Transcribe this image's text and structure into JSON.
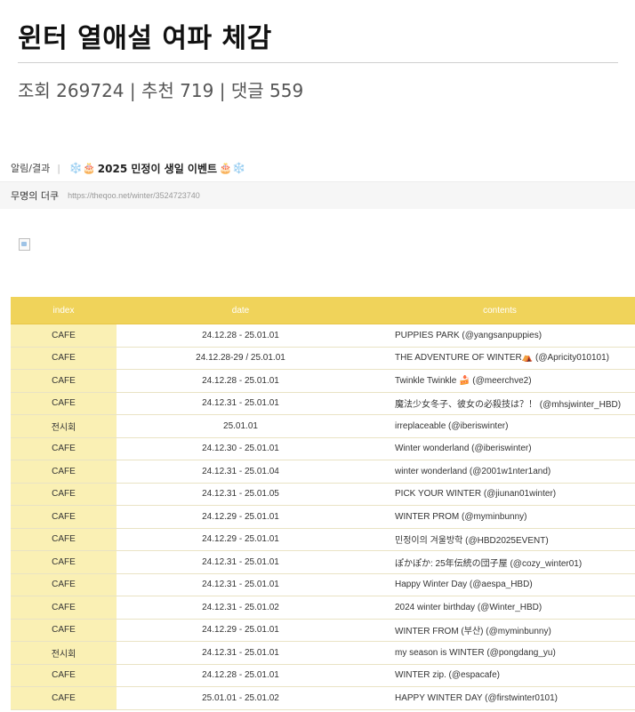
{
  "post": {
    "title": "윈터 열애설 여파 체감",
    "views_label": "조회",
    "views": "269724",
    "recs_label": "추천",
    "recs": "719",
    "comments_label": "댓글",
    "comments": "559",
    "divider": "|"
  },
  "meta": {
    "category": "알림/결과",
    "separator": "|",
    "emoji_left": "❄️🎂",
    "headline": "2025 민정이 생일 이벤트",
    "emoji_right": "🎂❄️",
    "author": "무명의 더쿠",
    "url": "https://theqoo.net/winter/3524723740"
  },
  "table": {
    "headers": {
      "index": "index",
      "date": "date",
      "contents": "contents"
    },
    "rows": [
      {
        "index": "CAFE",
        "date": "24.12.28 - 25.01.01",
        "contents": "PUPPIES PARK (@yangsanpuppies)"
      },
      {
        "index": "CAFE",
        "date": "24.12.28-29 / 25.01.01",
        "contents": "THE ADVENTURE OF WINTER⛺ (@Apricity010101)"
      },
      {
        "index": "CAFE",
        "date": "24.12.28 - 25.01.01",
        "contents": "Twinkle Twinkle 🍰 (@meerchve2)"
      },
      {
        "index": "CAFE",
        "date": "24.12.31 - 25.01.01",
        "contents": "魔法少女冬子、彼女の必殺技は？！ (@mhsjwinter_HBD)"
      },
      {
        "index": "전시회",
        "date": "25.01.01",
        "contents": "irreplaceable (@iberiswinter)"
      },
      {
        "index": "CAFE",
        "date": "24.12.30 - 25.01.01",
        "contents": "Winter wonderland (@iberiswinter)"
      },
      {
        "index": "CAFE",
        "date": "24.12.31 - 25.01.04",
        "contents": "winter wonderland (@2001w1nter1and)"
      },
      {
        "index": "CAFE",
        "date": "24.12.31 - 25.01.05",
        "contents": "PICK YOUR WINTER (@jiunan01winter)"
      },
      {
        "index": "CAFE",
        "date": "24.12.29 - 25.01.01",
        "contents": "WINTER PROM (@myminbunny)"
      },
      {
        "index": "CAFE",
        "date": "24.12.29 - 25.01.01",
        "contents": "민정이의 겨울방학 (@HBD2025EVENT)"
      },
      {
        "index": "CAFE",
        "date": "24.12.31 - 25.01.01",
        "contents": "ぽかぽか: 25年伝統の団子屋 (@cozy_winter01)"
      },
      {
        "index": "CAFE",
        "date": "24.12.31 - 25.01.01",
        "contents": "Happy Winter Day (@aespa_HBD)"
      },
      {
        "index": "CAFE",
        "date": "24.12.31 - 25.01.02",
        "contents": "2024 winter birthday (@Winter_HBD)"
      },
      {
        "index": "CAFE",
        "date": "24.12.29 - 25.01.01",
        "contents": "WINTER FROM (부산) (@myminbunny)"
      },
      {
        "index": "전시회",
        "date": "24.12.31 - 25.01.01",
        "contents": "my season is WINTER (@pongdang_yu)"
      },
      {
        "index": "CAFE",
        "date": "24.12.28 - 25.01.01",
        "contents": "WINTER zip. (@espacafe)"
      },
      {
        "index": "CAFE",
        "date": "25.01.01 - 25.01.02",
        "contents": "HAPPY WINTER DAY (@firstwinter0101)"
      }
    ]
  },
  "colors": {
    "header_bg": "#f0d35a",
    "index_cell_bg": "#faf0b4"
  }
}
